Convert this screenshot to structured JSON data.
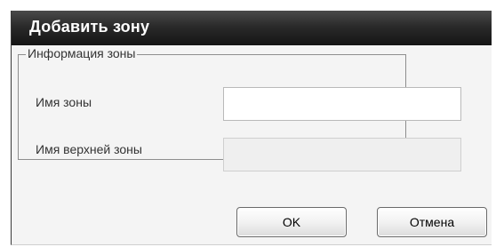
{
  "dialog": {
    "title": "Добавить зону",
    "group_label": "Информация зоны",
    "fields": [
      {
        "label": "Имя зоны",
        "value": "",
        "placeholder": ""
      },
      {
        "label": "Имя верхней зоны",
        "value": "",
        "placeholder": ""
      }
    ],
    "buttons": {
      "ok": "OK",
      "cancel": "Отмена"
    }
  },
  "colors": {
    "titlebar": "#1f1f1f",
    "dialog_background": "#f4f4f4",
    "readonly_field": "#efefef"
  }
}
